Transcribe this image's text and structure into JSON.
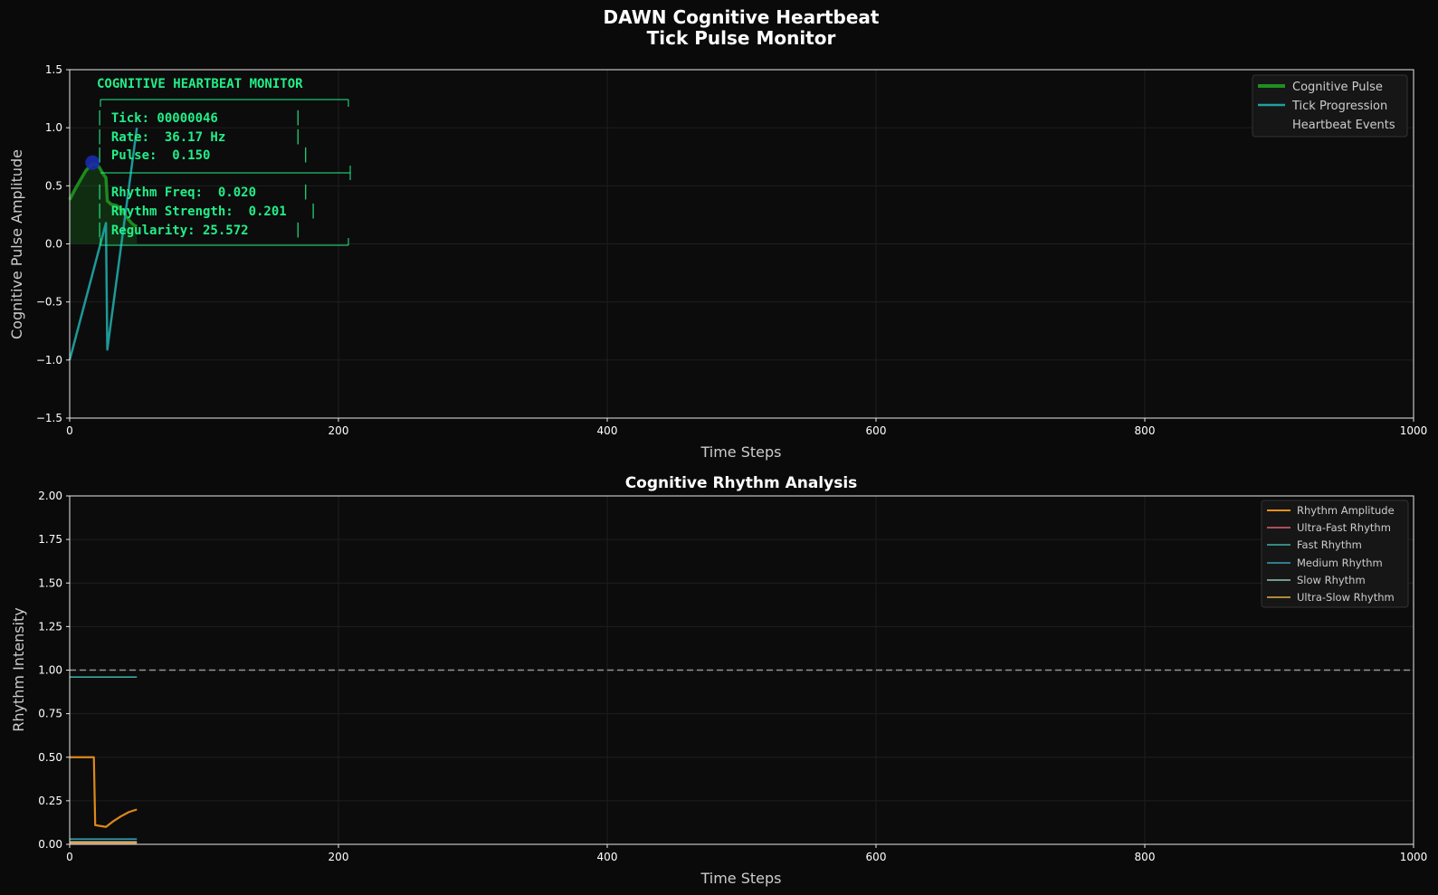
{
  "figure": {
    "title_line1": "DAWN Cognitive Heartbeat",
    "title_line2": "Tick Pulse Monitor",
    "background": "#0a0a0a",
    "axes_background": "#0c0c0c"
  },
  "chart_data": [
    {
      "type": "line",
      "title": "",
      "xlabel": "Time Steps",
      "ylabel": "Cognitive Pulse Amplitude",
      "xlim": [
        0,
        1000
      ],
      "ylim": [
        -1.5,
        1.5
      ],
      "xticks": [
        "0",
        "200",
        "400",
        "600",
        "800",
        "1000"
      ],
      "yticks": [
        "1.5",
        "1.0",
        "0.5",
        "0.0",
        "−0.5",
        "−1.0",
        "−1.5"
      ],
      "grid": true,
      "legend_position": "top-right",
      "series": [
        {
          "name": "Cognitive Pulse",
          "color": "#1f8f1f",
          "fill": true,
          "points": [
            [
              0,
              0.38
            ],
            [
              4,
              0.47
            ],
            [
              8,
              0.55
            ],
            [
              12,
              0.63
            ],
            [
              16,
              0.68
            ],
            [
              19,
              0.69
            ],
            [
              22,
              0.66
            ],
            [
              25,
              0.6
            ],
            [
              27,
              0.57
            ],
            [
              28,
              0.37
            ],
            [
              31,
              0.34
            ],
            [
              35,
              0.33
            ],
            [
              38,
              0.3
            ],
            [
              40,
              0.27
            ],
            [
              43,
              0.22
            ],
            [
              46,
              0.18
            ],
            [
              48,
              0.16
            ],
            [
              50,
              0.15
            ]
          ]
        },
        {
          "name": "Tick Progression",
          "color": "#20a0a0",
          "points": [
            [
              0,
              -1.0
            ],
            [
              27,
              0.18
            ],
            [
              28,
              -0.91
            ],
            [
              50,
              1.0
            ]
          ]
        },
        {
          "name": "Heartbeat Events",
          "color": "#1a2aa8",
          "points": [
            [
              17,
              0.7
            ]
          ]
        }
      ],
      "monitor_panel": {
        "title": "COGNITIVE HEARTBEAT MONITOR",
        "top_border": "┌────────────────────────────────┐",
        "line_tick": "│ Tick: 00000046          │",
        "line_rate": "│ Rate:  36.17 Hz         │",
        "line_pulse": "│ Pulse:  0.150            │",
        "middle_border": "├────────────────────────────────┤",
        "line_rhythm_freq": "│ Rhythm Freq:  0.020      │",
        "line_rhythm_strength": "│ Rhythm Strength:  0.201   │",
        "line_regularity": "│ Regularity: 25.572      │",
        "bottom_border": "└────────────────────────────────┘",
        "color": "#22ee88"
      }
    },
    {
      "type": "line",
      "title": "Cognitive Rhythm Analysis",
      "xlabel": "Time Steps",
      "ylabel": "Rhythm Intensity",
      "xlim": [
        0,
        1000
      ],
      "ylim": [
        0,
        2
      ],
      "xticks": [
        "0",
        "200",
        "400",
        "600",
        "800",
        "1000"
      ],
      "yticks": [
        "2.00",
        "1.75",
        "1.50",
        "1.25",
        "1.00",
        "0.75",
        "0.50",
        "0.25",
        "0.00"
      ],
      "grid": true,
      "legend_position": "top-right",
      "reference_line": {
        "y": 1.0,
        "style": "dashed",
        "color": "#aaaaaa"
      },
      "series": [
        {
          "name": "Rhythm Amplitude",
          "color": "#e8901c",
          "points": [
            [
              0,
              0.5
            ],
            [
              18,
              0.5
            ],
            [
              19,
              0.11
            ],
            [
              27,
              0.1
            ],
            [
              32,
              0.13
            ],
            [
              38,
              0.16
            ],
            [
              44,
              0.185
            ],
            [
              50,
              0.2
            ]
          ]
        },
        {
          "name": "Ultra-Fast Rhythm",
          "color": "#e06070",
          "points": [
            [
              0,
              0.005
            ],
            [
              50,
              0.005
            ]
          ]
        },
        {
          "name": "Fast Rhythm",
          "color": "#40b0a8",
          "points": [
            [
              0,
              0.96
            ],
            [
              50,
              0.96
            ]
          ]
        },
        {
          "name": "Medium Rhythm",
          "color": "#3aa0b8",
          "points": [
            [
              0,
              0.03
            ],
            [
              50,
              0.03
            ]
          ]
        },
        {
          "name": "Slow Rhythm",
          "color": "#90c8b0",
          "points": [
            [
              0,
              0.015
            ],
            [
              50,
              0.015
            ]
          ]
        },
        {
          "name": "Ultra-Slow Rhythm",
          "color": "#e0b040",
          "points": [
            [
              0,
              0.01
            ],
            [
              50,
              0.01
            ]
          ]
        }
      ]
    }
  ]
}
